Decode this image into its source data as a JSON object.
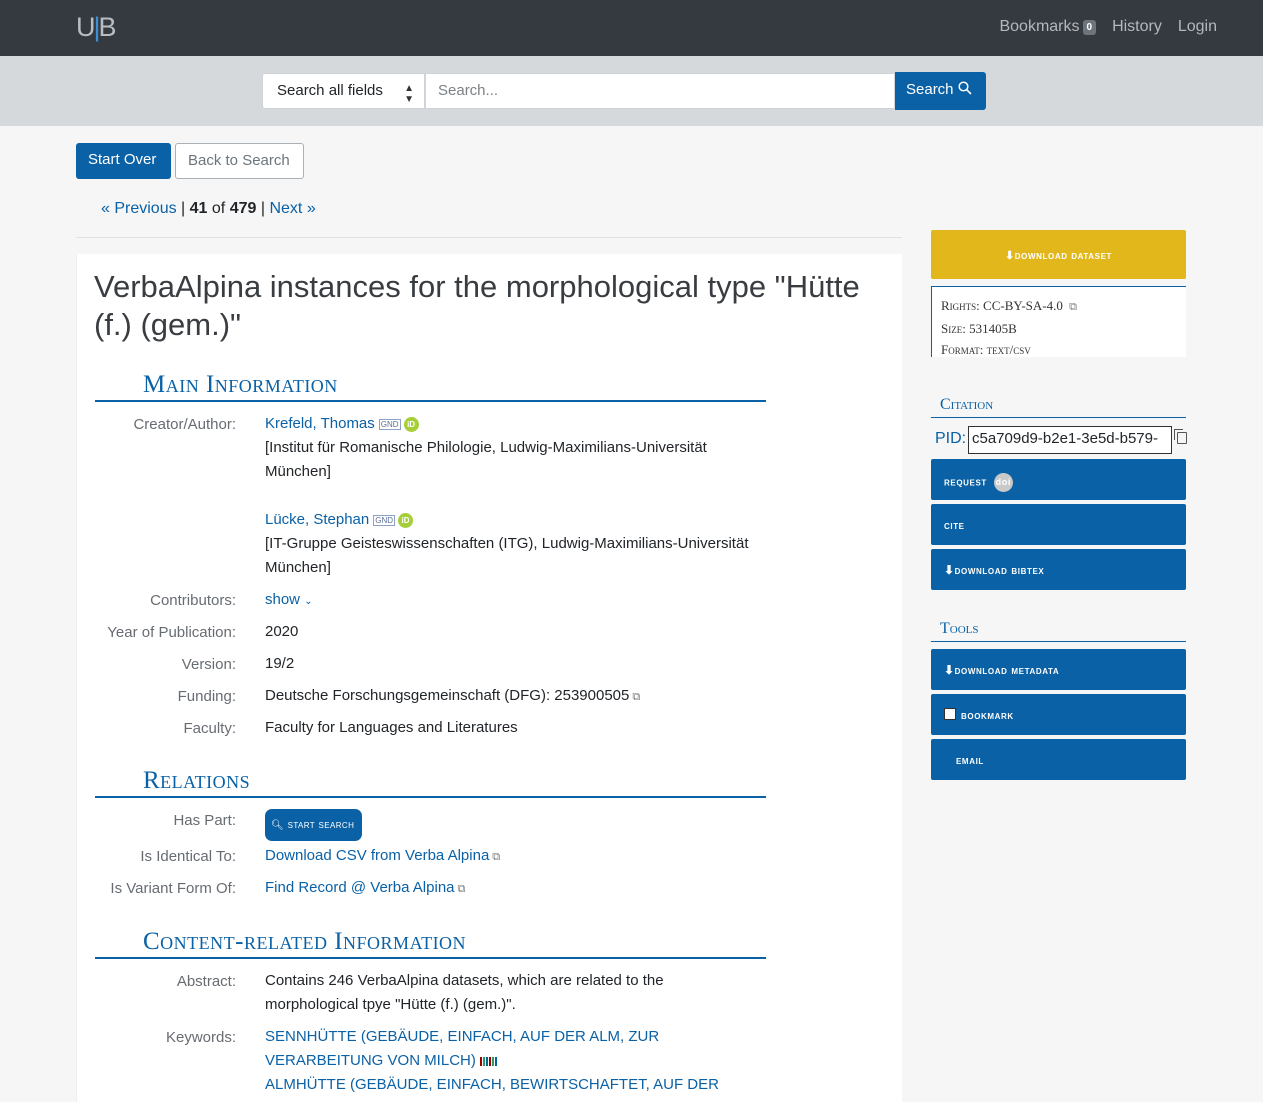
{
  "navbar": {
    "logo": "UB",
    "bookmarks_label": "Bookmarks",
    "bookmarks_count": "0",
    "history_label": "History",
    "login_label": "Login"
  },
  "search": {
    "type_label": "Search all fields",
    "placeholder": "Search...",
    "button_label": "Search"
  },
  "toolbar": {
    "start_over": "Start Over",
    "back_to_search": "Back to Search"
  },
  "pager": {
    "previous": "« Previous",
    "current": "41",
    "of": "of",
    "total": "479",
    "next": "Next »"
  },
  "record": {
    "title": "VerbaAlpina instances for the morphological type \"Hütte (f.) (gem.)\"",
    "main_info": {
      "heading": "Main Information",
      "creator_label": "Creator/Author:",
      "creators": [
        {
          "name": "Krefeld, Thomas",
          "affiliation": "[Institut für Romanische Philologie, Ludwig-Maximilians-Universität München]"
        },
        {
          "name": "Lücke, Stephan",
          "affiliation": "[IT-Gruppe Geisteswissenschaften (ITG), Ludwig-Maximilians-Universität München]"
        }
      ],
      "contributors_label": "Contributors:",
      "contributors_value": "show",
      "year_label": "Year of Publication:",
      "year_value": "2020",
      "version_label": "Version:",
      "version_value": "19/2",
      "funding_label": "Funding:",
      "funding_value": "Deutsche Forschungsgemeinschaft (DFG): 253900505",
      "faculty_label": "Faculty:",
      "faculty_value": "Faculty for Languages and Literatures"
    },
    "relations": {
      "heading": "Relations",
      "has_part_label": "Has Part:",
      "has_part_button": "start search",
      "identical_label": "Is Identical To:",
      "identical_value": "Download CSV from Verba Alpina",
      "variant_label": "Is Variant Form Of:",
      "variant_value": "Find Record @ Verba Alpina"
    },
    "content": {
      "heading": "Content-related Information",
      "abstract_label": "Abstract:",
      "abstract_value": "Contains 246 VerbaAlpina datasets, which are related to the morphological tpye \"Hütte (f.) (gem.)\".",
      "keywords_label": "Keywords:",
      "keywords": [
        "SENNHÜTTE (GEBÄUDE, EINFACH, AUF DER ALM, ZUR VERARBEITUNG VON MILCH)",
        "ALMHÜTTE (GEBÄUDE, EINFACH, BEWIRTSCHAFTET, AUF DER ALM)"
      ]
    }
  },
  "sidebar": {
    "download_dataset": "download dataset",
    "rights": "Rights: CC-BY-SA-4.0",
    "size": "Size: 531405B",
    "format": "Format: text/csv",
    "citation_heading": "Citation",
    "pid_label": "PID:",
    "pid_value": "c5a709d9-b2e1-3e5d-b579-",
    "request_label": "request",
    "doi_label": "doi",
    "cite_label": "cite",
    "download_bibtex": "download bibtex",
    "tools_heading": "Tools",
    "download_metadata": "download metadata",
    "bookmark": "bookmark",
    "email": "email"
  },
  "colors": {
    "primary": "#0a61a6",
    "download": "#e2b71c",
    "navbar": "#343a40"
  }
}
